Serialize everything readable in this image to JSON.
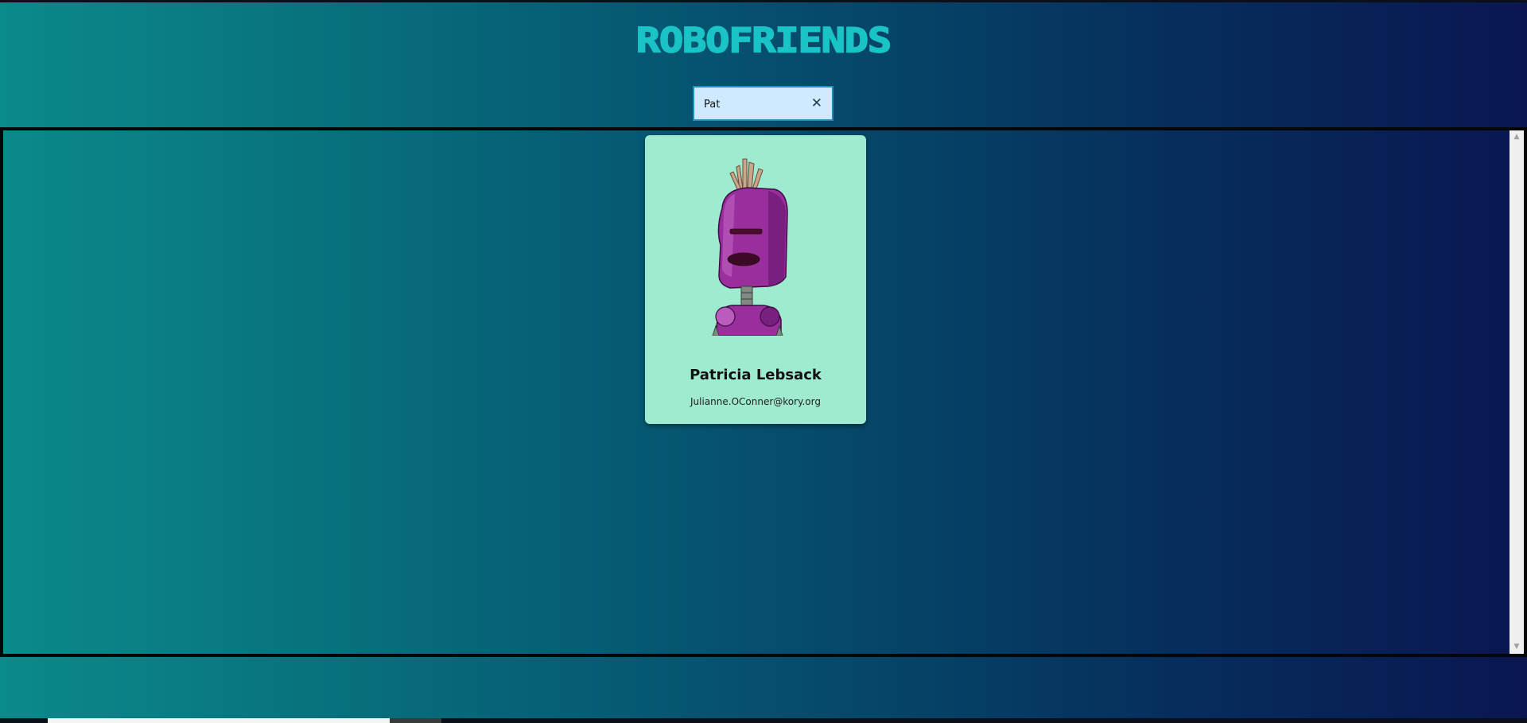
{
  "app": {
    "title": "ROBOFRIENDS"
  },
  "search": {
    "value": "Pat",
    "placeholder": "",
    "clear_icon": "close-icon",
    "clear_glyph": "✕"
  },
  "cards": [
    {
      "name": "Patricia Lebsack",
      "email": "Julianne.OConner@kory.org",
      "avatar_icon": "robot-avatar"
    }
  ],
  "colors": {
    "title": "#19c3c6",
    "card_bg": "#9eebd0",
    "search_bg": "#cfeaff",
    "gradient_start": "#0b8a8a",
    "gradient_end": "#0a1650"
  }
}
